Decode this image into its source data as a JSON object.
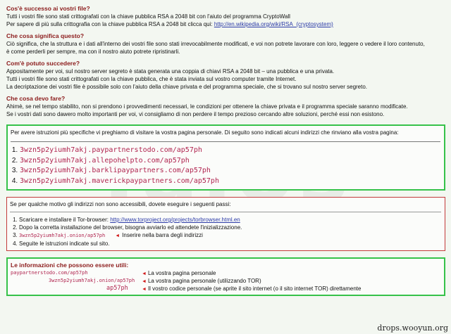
{
  "watermark": "Talos",
  "sections": [
    {
      "heading": "Cos'è successo ai vostri file?",
      "lines": [
        "Tutti i vostri file sono stati crittografati con la chiave pubblica RSA a 2048 bit con l'aiuto del programma CryptoWall"
      ],
      "link_line_prefix": "Per sapere di più sulla crittografia con la chiave pubblica RSA a 2048 bit clicca qui: ",
      "link_text": "http://en.wikipedia.org/wiki/RSA_(cryptosystem)"
    },
    {
      "heading": "Che cosa significa questo?",
      "lines": [
        "Ciò significa, che la struttura e i dati all'interno dei vostri file sono stati irrevocabilmente modificati, e voi non potrete lavorare con loro, leggere o vedere il loro contenuto,",
        "è come perderli per sempre, ma con il nostro aiuto potrete ripristinarli."
      ]
    },
    {
      "heading": "Com'è potuto succedere?",
      "lines": [
        "Appositamente per voi, sul nostro server segreto è stata generata una coppia di chiavi RSA a 2048 bit – una pubblica e una privata.",
        "Tutti i vostri file sono stati crittografati con la chiave pubblica, che è stata inviata sul vostro computer tramite Internet.",
        "La decriptazione dei vostri file è possibile solo con l'aiuto della chiave privata e del programma speciale, che si trovano sul nostro server segreto."
      ]
    },
    {
      "heading": "Che cosa devo fare?",
      "lines": [
        "Ahimè, se nel tempo stabilito, non si prendono i provvedimenti necessari, le condizioni per ottenere la chiave privata e il programma speciale saranno modificate.",
        "Se i vostri dati sono dawero molto importanti per voi, vi consigliamo di non perdere il tempo prezioso cercando altre soluzioni, perché essi non esistono."
      ]
    }
  ],
  "box1": {
    "intro": "Per avere istruzioni più specifiche vi preghiamo di visitare la vostra pagina personale. Di seguito sono indicati alcuni indirizzi che rinviano alla vostra pagina:",
    "links": [
      "3wzn5p2yiumh7akj.paypartnerstodo.com/ap57ph",
      "3wzn5p2yiumh7akj.allepohelpto.com/ap57ph",
      "3wzn5p2yiumh7akj.barklipaypartners.com/ap57ph",
      "3wzn5p2yiumh7akj.maverickpaypartners.com/ap57ph"
    ]
  },
  "box2": {
    "intro": "Se per qualche motivo gli indirizzi non sono accessibili, dovete eseguire i seguenti passi:",
    "step1_prefix": "Scaricare e installare il Tor-browser: ",
    "step1_link": "http://www.torproject.org/projects/torbrowser.html.en",
    "step2": "Dopo la corretta installazione del browser, bisogna avviarlo ed attendete l'inizializzazione.",
    "step3_code": "3wzn5p2yiumh7akj.onion/ap57ph",
    "step3_arrow": "◄",
    "step3_text": "Inserire nella barra degli indirizzi",
    "step4": "Seguite le istruzioni indicate sul sito."
  },
  "box3": {
    "title": "Le informazioni che possono essere utili:",
    "rows": [
      {
        "link": "paypartnerstodo.com/ap57ph",
        "arrow": "◄",
        "desc": "La vostra pagina personale"
      },
      {
        "link": "3wzn5p2yiumh7akj.onion/ap57ph",
        "arrow": "◄",
        "desc": "La vostra pagina personale (utilizzando TOR)"
      },
      {
        "link": "ap57ph",
        "arrow": "◄",
        "desc": "Il vostro codice personale (se aprite il sito internet (o il sito internet TOR) direttamente"
      }
    ]
  },
  "footer_credit": "drops.wooyun.org"
}
